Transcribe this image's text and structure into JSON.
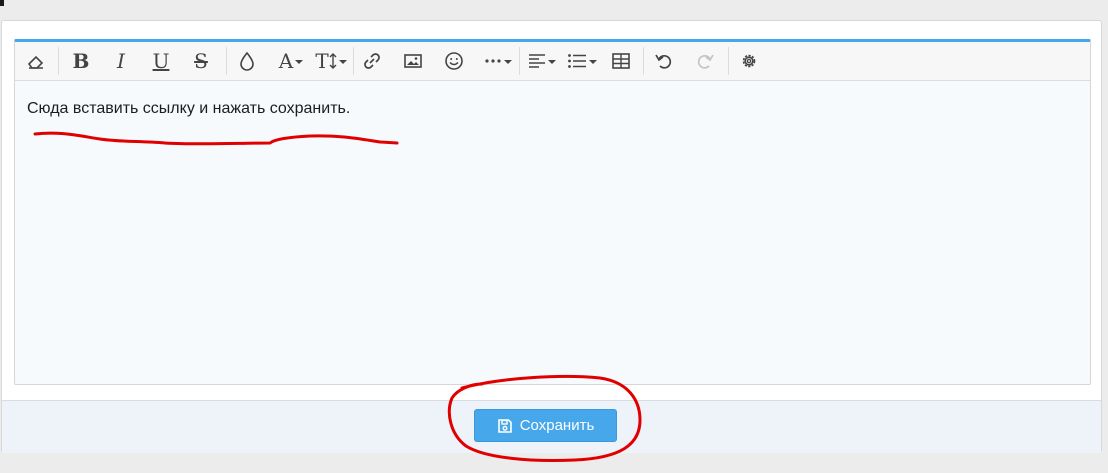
{
  "editor": {
    "content_text": "Сюда вставить ссылку и нажать сохранить.",
    "accent_color": "#47a7eb",
    "toolbar_icons": [
      "eraser-icon",
      "bold-icon",
      "italic-icon",
      "underline-icon",
      "strikethrough-icon",
      "text-color-icon",
      "font-family-icon",
      "font-size-icon",
      "link-icon",
      "image-icon",
      "emoji-icon",
      "more-options-icon",
      "align-icon",
      "list-icon",
      "table-icon",
      "undo-icon",
      "redo-icon",
      "settings-icon"
    ],
    "toolbar_letters": {
      "bold": "B",
      "italic": "I",
      "underline": "U",
      "strike": "S",
      "font_family": "A",
      "font_size": "T"
    }
  },
  "footer": {
    "save_label": "Сохранить",
    "save_icon": "save-icon",
    "button_color": "#47a7eb"
  },
  "annotation": {
    "color": "#e00000",
    "marks": [
      "underline-stroke",
      "circle-around-save-button"
    ]
  }
}
